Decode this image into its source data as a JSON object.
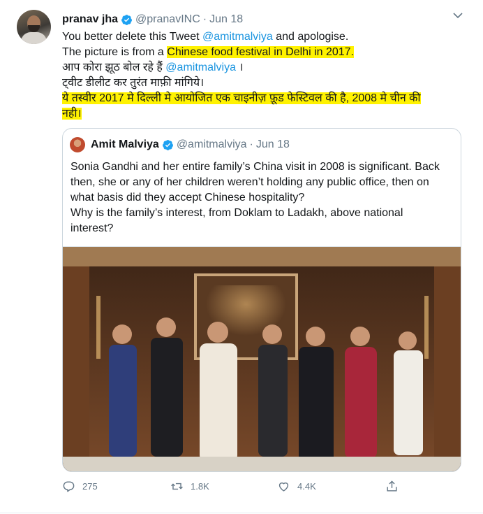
{
  "tweet": {
    "author_name": "pranav jha",
    "author_handle": "@pranavINC",
    "separator": "·",
    "date": "Jun 18",
    "lines": {
      "l1_text": "You better delete this Tweet ",
      "l1_mention": "@amitmalviya",
      "l1_end": " and apologise.",
      "l2_text": "The picture is from a ",
      "l2_highlight": "Chinese food festival in Delhi in 2017.",
      "l3_text": "आप कोरा झूठ बोल रहे हैं ",
      "l3_mention": "@amitmalviya",
      "l3_end": " ।",
      "l4_text": "ट्वीट डीलीट कर तुरंत माफ़ी मांगिये।",
      "l5_highlight": "ये तस्वीर 2017 मे दिल्ली मे आयोजित एक चाइनीज़ फ़ूड फेस्टिवल की है, 2008 मे चीन की",
      "l6_highlight": "नही।"
    }
  },
  "quoted": {
    "author_name": "Amit Malviya",
    "author_handle": "@amitmalviya",
    "separator": "·",
    "date": "Jun 18",
    "text_lines": [
      "Sonia Gandhi and her entire family’s China visit in 2008 is significant. Back",
      "then, she or any of her children weren’t holding any public office, then on",
      "what basis did they accept Chinese hospitality?",
      "Why is the family’s interest, from Doklam to Ladakh, above national",
      "interest?"
    ]
  },
  "actions": {
    "reply_count": "275",
    "retweet_count": "1.8K",
    "like_count": "4.4K"
  },
  "colors": {
    "link": "#1b95e0",
    "highlight": "#fff200",
    "muted": "#657786"
  },
  "icons": [
    "verified-badge-icon",
    "more-chevron-icon",
    "reply-icon",
    "retweet-icon",
    "like-icon",
    "share-icon"
  ]
}
